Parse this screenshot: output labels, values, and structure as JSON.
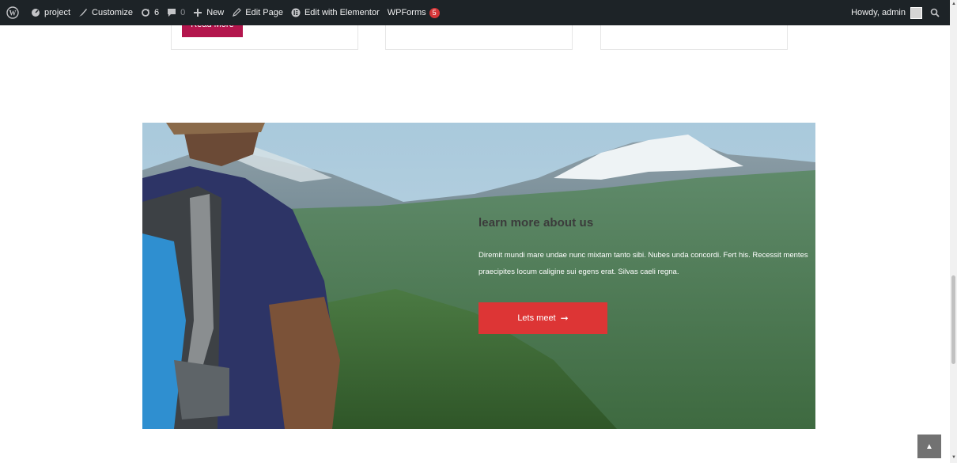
{
  "adminbar": {
    "items": [
      {
        "label": "",
        "icon": "wordpress-icon"
      },
      {
        "label": "project",
        "icon": "dashboard-icon"
      },
      {
        "label": "Customize",
        "icon": "brush-icon"
      },
      {
        "label": "6",
        "icon": "updates-icon"
      },
      {
        "label": "0",
        "icon": "comments-icon"
      },
      {
        "label": "New",
        "icon": "plus-icon"
      },
      {
        "label": "Edit Page",
        "icon": "pencil-icon"
      },
      {
        "label": "Edit with Elementor",
        "icon": "elementor-icon"
      },
      {
        "label": "WPForms",
        "badge": "5"
      }
    ],
    "greeting": "Howdy, admin"
  },
  "cards": {
    "read_more_label": "Read More"
  },
  "hero": {
    "title": "learn more about us",
    "text": "Diremit mundi mare undae nunc mixtam tanto sibi. Nubes unda concordi. Fert his. Recessit mentes praecipites locum caligine sui egens erat. Silvas caeli regna.",
    "button_label": "Lets meet",
    "button_color": "#dd3535"
  },
  "colors": {
    "adminbar_bg": "#1d2327",
    "read_more_bg": "#b3164d"
  }
}
